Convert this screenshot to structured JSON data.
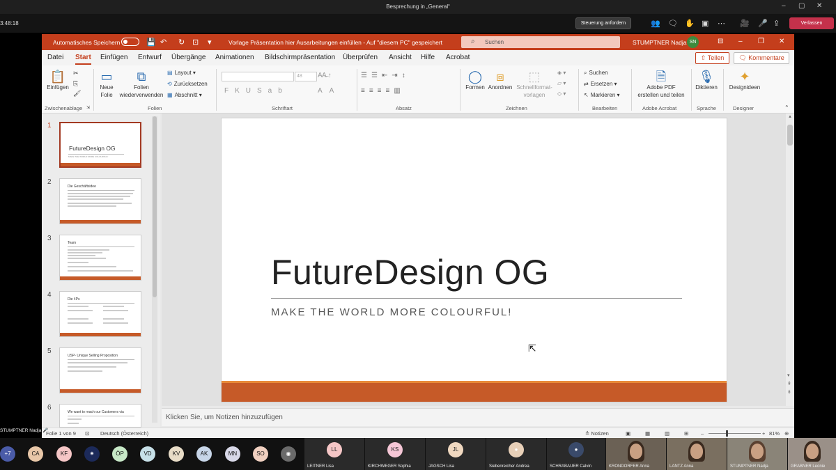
{
  "teams": {
    "window_title": "Besprechung in „General“",
    "elapsed": "3:48:18",
    "request_control": "Steuerung anfordern",
    "leave": "Verlassen",
    "presenter": "STUMPTNER Nadja"
  },
  "ppt": {
    "autosave_label": "Automatisches Speichern",
    "doc_title": "Vorlage Präsentation hier Ausarbeitungen einfüllen  -  Auf \"diesem PC\" gespeichert",
    "search_placeholder": "Suchen",
    "user_name": "STUMPTNER Nadja",
    "user_initials": "SN",
    "menu": [
      "Datei",
      "Start",
      "Einfügen",
      "Entwurf",
      "Übergänge",
      "Animationen",
      "Bildschirmpräsentation",
      "Überprüfen",
      "Ansicht",
      "Hilfe",
      "Acrobat"
    ],
    "share": "Teilen",
    "comments": "Kommentare",
    "ribbon": {
      "paste": "Einfügen",
      "clipboard_group": "Zwischenablage",
      "new_slide_1": "Neue",
      "new_slide_2": "Folie",
      "reuse_1": "Folien",
      "reuse_2": "wiederverwenden",
      "layout": "Layout",
      "reset": "Zurücksetzen",
      "section": "Abschnitt",
      "slides_group": "Folien",
      "font_size": "48",
      "font_group": "Schriftart",
      "paragraph_group": "Absatz",
      "shapes": "Formen",
      "arrange": "Anordnen",
      "quickstyles_1": "Schnellformat-",
      "quickstyles_2": "vorlagen",
      "drawing_group": "Zeichnen",
      "find": "Suchen",
      "replace": "Ersetzen",
      "select": "Markieren",
      "editing_group": "Bearbeiten",
      "pdf_1": "Adobe PDF",
      "pdf_2": "erstellen und teilen",
      "acrobat_group": "Adobe Acrobat",
      "dictate": "Diktieren",
      "voice_group": "Sprache",
      "designer": "Designideen",
      "designer_group": "Designer"
    },
    "thumbnails": [
      {
        "num": "1",
        "title": "FutureDesign OG",
        "subtitle": "MAKE THE WORLD MORE COLOURFUL!"
      },
      {
        "num": "2",
        "title": "Die Geschäftsidee"
      },
      {
        "num": "3",
        "title": "Team"
      },
      {
        "num": "4",
        "title": "Die 4Ps"
      },
      {
        "num": "5",
        "title": "USP- Unique Selling Proposition"
      },
      {
        "num": "6",
        "title": "We want to reach our Customers via"
      }
    ],
    "slide": {
      "title": "FutureDesign OG",
      "subtitle": "MAKE THE WORLD MORE COLOURFUL!"
    },
    "notes_placeholder": "Klicken Sie, um Notizen hinzuzufügen",
    "status": {
      "slide_of": "Folie 1 von 9",
      "language": "Deutsch (Österreich)",
      "notes": "Notizen",
      "zoom": "81%"
    }
  },
  "participants": {
    "more": "+7",
    "avatars": [
      {
        "initials": "CA",
        "color": "#e8c7a8"
      },
      {
        "initials": "KF",
        "color": "#f5c6c6"
      },
      {
        "initials": "ÖP",
        "color": "#c7e8c7"
      },
      {
        "initials": "VD",
        "color": "#c7e0e8"
      },
      {
        "initials": "KV",
        "color": "#e8dcc7"
      },
      {
        "initials": "AK",
        "color": "#c7d5e8"
      },
      {
        "initials": "MN",
        "color": "#d8d8e8"
      },
      {
        "initials": "SO",
        "color": "#f0d0c0"
      }
    ],
    "tiles": [
      {
        "initials": "LL",
        "name": "LEITNER Lisa",
        "color": "#f5c6c6"
      },
      {
        "initials": "KS",
        "name": "KIRCHWEGER Sophia",
        "color": "#f5c6d6"
      },
      {
        "initials": "JL",
        "name": "JAGSCH Lisa",
        "color": "#f0d8c0"
      },
      {
        "initials": "",
        "name": "Siebenreicher Andrea",
        "color": "#e8d0b8"
      },
      {
        "initials": "",
        "name": "SCHRABAUER Calvin",
        "color": "#3a4a6a"
      }
    ],
    "video_tiles": [
      {
        "name": "KRONDORFER Anna"
      },
      {
        "name": "LANTZ Anna"
      },
      {
        "name": "STUMPTNER Nadja"
      },
      {
        "name": "GRABNER Leonie"
      }
    ]
  }
}
